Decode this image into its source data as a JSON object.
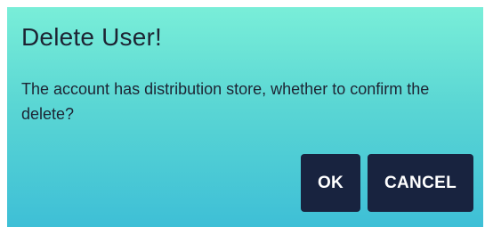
{
  "dialog": {
    "title": "Delete User!",
    "message": "The account has distribution store, whether to confirm the delete?",
    "buttons": {
      "ok_label": "OK",
      "cancel_label": "CANCEL"
    },
    "colors": {
      "gradient_top": "#79eed8",
      "gradient_bottom": "#3ebfd6",
      "button_background": "#18233f",
      "button_text": "#ffffff",
      "text": "#1d2433"
    }
  }
}
